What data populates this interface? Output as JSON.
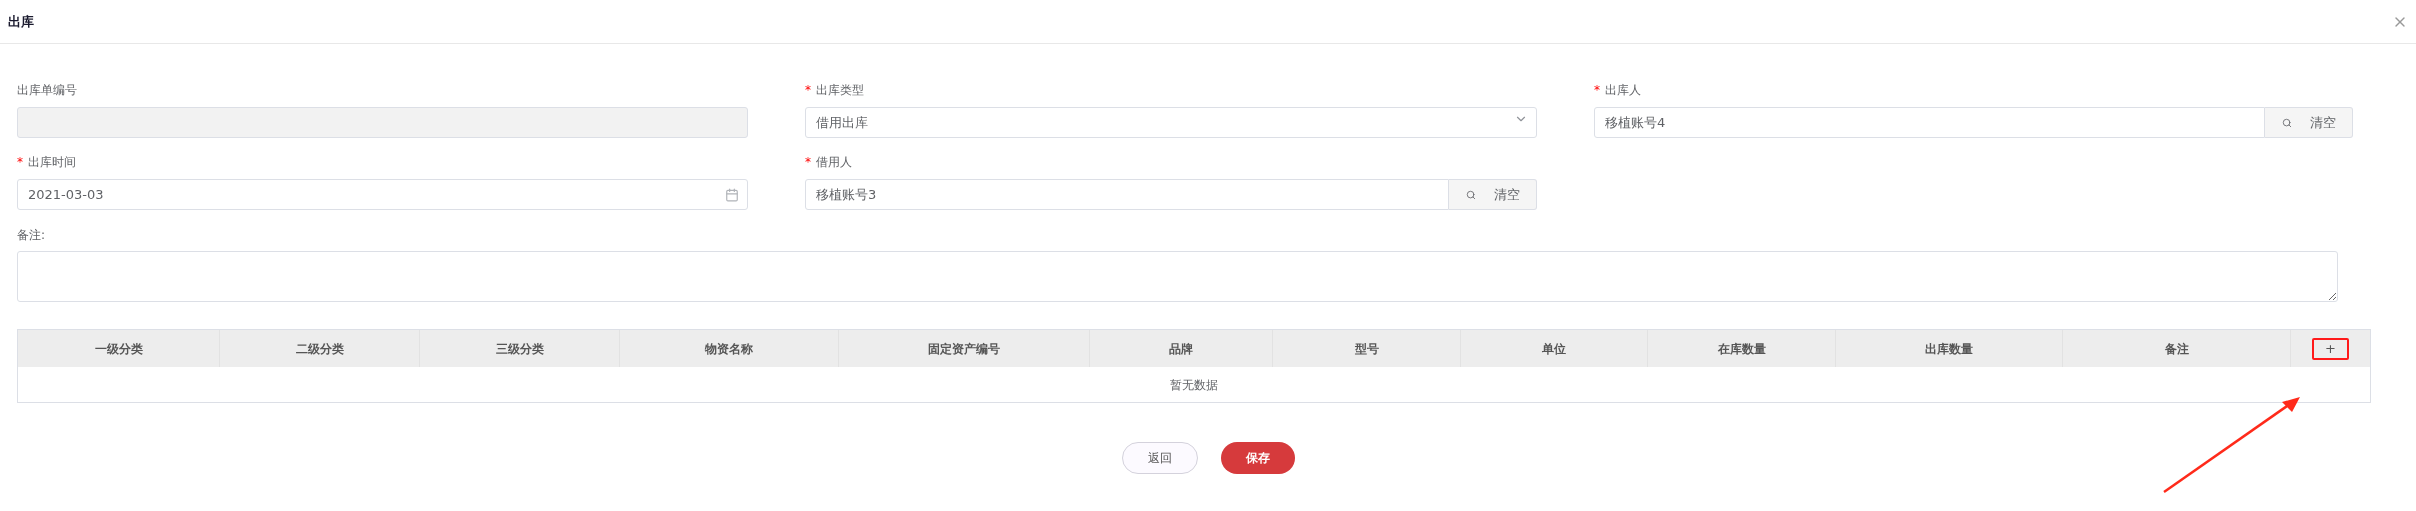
{
  "dialog": {
    "title": "出库"
  },
  "required_mark": "*",
  "fields": [
    {
      "kind": "text",
      "label": "出库单编号",
      "required": false,
      "disabled": true
    },
    {
      "kind": "select",
      "label": "出库类型",
      "required": true,
      "value": "借用出库",
      "disabled": false
    },
    {
      "kind": "lookup",
      "label": "出库人",
      "required": true,
      "value": "移植账号4",
      "button": "清空",
      "disabled": false
    },
    {
      "kind": "date",
      "label": "出库时间",
      "required": true,
      "value": "2021-03-03",
      "disabled": false
    },
    {
      "kind": "lookup",
      "label": "借用人",
      "required": true,
      "value": "移植账号3",
      "button": "清空",
      "disabled": false
    }
  ],
  "remark": {
    "label": "备注:"
  },
  "table": {
    "columns": [
      "一级分类",
      "二级分类",
      "三级分类",
      "物资名称",
      "固定资产编号",
      "品牌",
      "型号",
      "单位",
      "在库数量",
      "出库数量",
      "备注"
    ],
    "add_button": "+",
    "empty_text": "暂无数据"
  },
  "buttons": [
    {
      "label": "返回",
      "kind": "secondary"
    },
    {
      "label": "保存",
      "kind": "primary"
    }
  ]
}
